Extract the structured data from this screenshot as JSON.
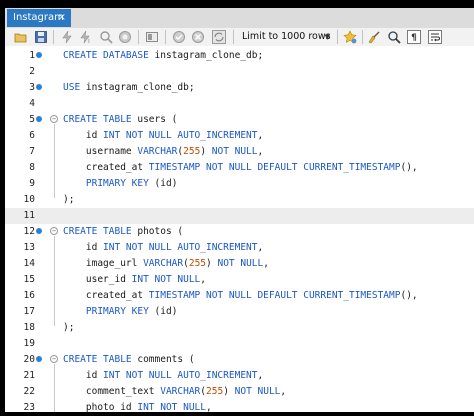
{
  "tab": {
    "title": "Instagram",
    "close": "×"
  },
  "toolbar": {
    "limit_label": "Limit to 1000 rows",
    "icons": [
      "folder-icon",
      "save-icon",
      "execute-icon",
      "execute-current-icon",
      "explain-icon",
      "stop-icon",
      "toggle-icon",
      "commit-icon",
      "rollback-icon",
      "autocommit-icon",
      "bookmark-icon",
      "beautify-icon",
      "find-icon",
      "invisibles-icon",
      "wrap-icon"
    ]
  },
  "editor": {
    "lines": [
      {
        "n": "1",
        "marker": true,
        "fold": false,
        "tokens": [
          [
            "kw",
            "CREATE DATABASE "
          ],
          [
            "t",
            "instagram_clone_db;"
          ]
        ]
      },
      {
        "n": "2",
        "marker": false,
        "fold": false,
        "tokens": []
      },
      {
        "n": "3",
        "marker": true,
        "fold": false,
        "tokens": [
          [
            "kw",
            "USE "
          ],
          [
            "t",
            "instagram_clone_db;"
          ]
        ]
      },
      {
        "n": "4",
        "marker": false,
        "fold": false,
        "tokens": []
      },
      {
        "n": "5",
        "marker": true,
        "fold": true,
        "tokens": [
          [
            "kw",
            "CREATE TABLE "
          ],
          [
            "t",
            "users ("
          ]
        ]
      },
      {
        "n": "6",
        "marker": false,
        "fold": false,
        "tokens": [
          [
            "t",
            "    id "
          ],
          [
            "kw",
            "INT NOT NULL AUTO_INCREMENT"
          ],
          [
            "t",
            ","
          ]
        ]
      },
      {
        "n": "7",
        "marker": false,
        "fold": false,
        "tokens": [
          [
            "t",
            "    username "
          ],
          [
            "kw",
            "VARCHAR"
          ],
          [
            "t",
            "("
          ],
          [
            "num",
            "255"
          ],
          [
            "t",
            ") "
          ],
          [
            "kw",
            "NOT NULL"
          ],
          [
            "t",
            ","
          ]
        ]
      },
      {
        "n": "8",
        "marker": false,
        "fold": false,
        "tokens": [
          [
            "t",
            "    created_at "
          ],
          [
            "kw",
            "TIMESTAMP NOT NULL DEFAULT CURRENT_TIMESTAMP"
          ],
          [
            "t",
            "(),"
          ]
        ]
      },
      {
        "n": "9",
        "marker": false,
        "fold": false,
        "tokens": [
          [
            "t",
            "    "
          ],
          [
            "kw",
            "PRIMARY KEY "
          ],
          [
            "t",
            "(id)"
          ]
        ]
      },
      {
        "n": "10",
        "marker": false,
        "fold": false,
        "tokens": [
          [
            "t",
            ");"
          ]
        ]
      },
      {
        "n": "11",
        "marker": false,
        "fold": false,
        "tokens": []
      },
      {
        "n": "12",
        "marker": true,
        "fold": true,
        "tokens": [
          [
            "kw",
            "CREATE TABLE "
          ],
          [
            "t",
            "photos ("
          ]
        ]
      },
      {
        "n": "13",
        "marker": false,
        "fold": false,
        "tokens": [
          [
            "t",
            "    id "
          ],
          [
            "kw",
            "INT NOT NULL AUTO_INCREMENT"
          ],
          [
            "t",
            ","
          ]
        ]
      },
      {
        "n": "14",
        "marker": false,
        "fold": false,
        "tokens": [
          [
            "t",
            "    image_url "
          ],
          [
            "kw",
            "VARCHAR"
          ],
          [
            "t",
            "("
          ],
          [
            "num",
            "255"
          ],
          [
            "t",
            ") "
          ],
          [
            "kw",
            "NOT NULL"
          ],
          [
            "t",
            ","
          ]
        ]
      },
      {
        "n": "15",
        "marker": false,
        "fold": false,
        "tokens": [
          [
            "t",
            "    user_id "
          ],
          [
            "kw",
            "INT NOT NULL"
          ],
          [
            "t",
            ","
          ]
        ]
      },
      {
        "n": "16",
        "marker": false,
        "fold": false,
        "tokens": [
          [
            "t",
            "    created_at "
          ],
          [
            "kw",
            "TIMESTAMP NOT NULL DEFAULT CURRENT_TIMESTAMP"
          ],
          [
            "t",
            "(),"
          ]
        ]
      },
      {
        "n": "17",
        "marker": false,
        "fold": false,
        "tokens": [
          [
            "t",
            "    "
          ],
          [
            "kw",
            "PRIMARY KEY "
          ],
          [
            "t",
            "(id)"
          ]
        ]
      },
      {
        "n": "18",
        "marker": false,
        "fold": false,
        "tokens": [
          [
            "t",
            ");"
          ]
        ]
      },
      {
        "n": "19",
        "marker": false,
        "fold": false,
        "tokens": []
      },
      {
        "n": "20",
        "marker": true,
        "fold": true,
        "tokens": [
          [
            "kw",
            "CREATE TABLE "
          ],
          [
            "t",
            "comments ("
          ]
        ]
      },
      {
        "n": "21",
        "marker": false,
        "fold": false,
        "tokens": [
          [
            "t",
            "    id "
          ],
          [
            "kw",
            "INT NOT NULL AUTO_INCREMENT"
          ],
          [
            "t",
            ","
          ]
        ]
      },
      {
        "n": "22",
        "marker": false,
        "fold": false,
        "tokens": [
          [
            "t",
            "    comment_text "
          ],
          [
            "kw",
            "VARCHAR"
          ],
          [
            "t",
            "("
          ],
          [
            "num",
            "255"
          ],
          [
            "t",
            ") "
          ],
          [
            "kw",
            "NOT NULL"
          ],
          [
            "t",
            ","
          ]
        ]
      },
      {
        "n": "23",
        "marker": false,
        "fold": false,
        "tokens": [
          [
            "t",
            "    photo_id "
          ],
          [
            "kw",
            "INT NOT NULL"
          ],
          [
            "t",
            ","
          ]
        ]
      }
    ],
    "highlighted_line": "11"
  },
  "colors": {
    "tab": "#2b79c2",
    "keyword": "#1b57c7",
    "number": "#c14a00",
    "marker": "#2f7de1",
    "current_line": "#ededed"
  }
}
